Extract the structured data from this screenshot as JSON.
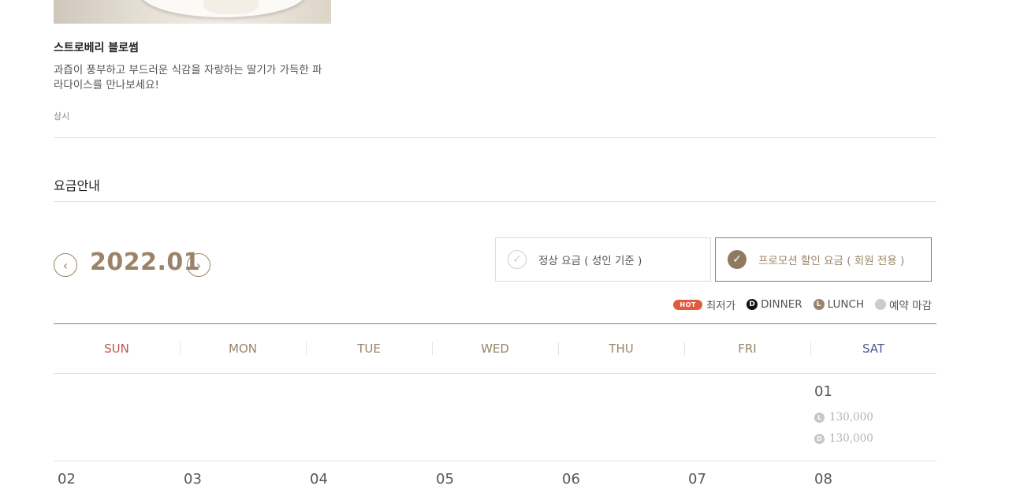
{
  "menu_item": {
    "title": "스트로베리 블로썸",
    "description": "과즙이 풍부하고 부드러운 식감을 자랑하는 딸기가 가득한 파라다이스를 만나보세요!",
    "period": "상시"
  },
  "rates_section": {
    "title": "요금안내",
    "month": "2022.01",
    "prev_icon": "chevron-left-icon",
    "next_icon": "chevron-right-icon",
    "prev_glyph": "‹",
    "next_glyph": "›",
    "rate_options": [
      {
        "label": "정상 요금 ( 성인 기준 )",
        "selected": false,
        "check_glyph": "✓"
      },
      {
        "label": "프로모션 할인 요금 ( 회원 전용 )",
        "selected": true,
        "check_glyph": "✓"
      }
    ]
  },
  "legend": {
    "hot_badge": "HOT",
    "lowest": "최저가",
    "dinner_letter": "D",
    "dinner": "DINNER",
    "lunch_letter": "L",
    "lunch": "LUNCH",
    "closed": "예약 마감"
  },
  "calendar": {
    "weekdays": [
      "SUN",
      "MON",
      "TUE",
      "WED",
      "THU",
      "FRI",
      "SAT"
    ],
    "week1": {
      "sat": {
        "day": "01",
        "lunch_letter": "L",
        "lunch_price": "130,000",
        "dinner_letter": "D",
        "dinner_price": "130,000"
      }
    },
    "week2": [
      "02",
      "03",
      "04",
      "05",
      "06",
      "07",
      "08"
    ]
  },
  "colors": {
    "accent": "#9a8469",
    "border_accent": "#8f7a5f",
    "sunday": "#c0574c",
    "saturday": "#4b5a96",
    "hot": "#e15a3c",
    "closed": "#cccccc"
  }
}
